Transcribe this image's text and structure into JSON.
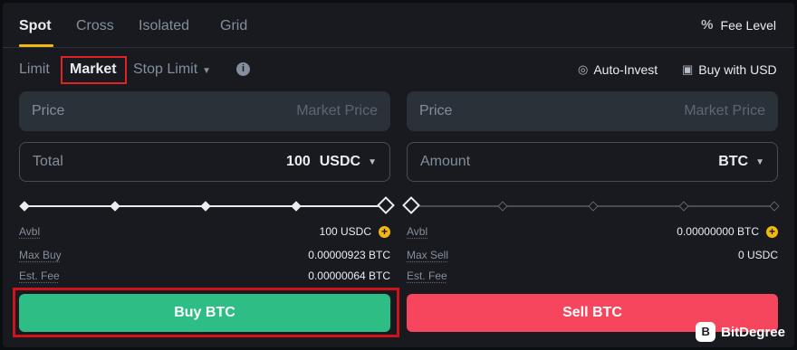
{
  "tabs": [
    {
      "label": "Spot",
      "active": true
    },
    {
      "label": "Cross",
      "active": false
    },
    {
      "label": "Isolated",
      "active": false
    },
    {
      "label": "Grid",
      "active": false
    }
  ],
  "fee_level": {
    "label": "Fee Level",
    "icon": "percent-icon"
  },
  "order_types": {
    "limit": "Limit",
    "market": "Market",
    "stop_limit": "Stop Limit",
    "selected": "Market"
  },
  "links": {
    "auto_invest": "Auto-Invest",
    "buy_with": "Buy with USD"
  },
  "buy": {
    "price_label": "Price",
    "price_placeholder": "Market Price",
    "total_label": "Total",
    "total_value": "100",
    "total_unit": "USDC",
    "slider_percent": 100,
    "avbl_label": "Avbl",
    "avbl_value": "100 USDC",
    "max_label": "Max Buy",
    "max_value": "0.00000923 BTC",
    "fee_label": "Est. Fee",
    "fee_value": "0.00000064 BTC",
    "button": "Buy BTC"
  },
  "sell": {
    "price_label": "Price",
    "price_placeholder": "Market Price",
    "amount_label": "Amount",
    "amount_unit": "BTC",
    "slider_percent": 0,
    "avbl_label": "Avbl",
    "avbl_value": "0.00000000 BTC",
    "max_label": "Max Sell",
    "max_value": "0 USDC",
    "fee_label": "Est. Fee",
    "button": "Sell BTC"
  },
  "watermark": {
    "text": "BitDegree",
    "logo": "B"
  },
  "colors": {
    "buy": "#2ebd85",
    "sell": "#f6465d",
    "accent": "#f0b90b",
    "highlight": "#e02424"
  }
}
